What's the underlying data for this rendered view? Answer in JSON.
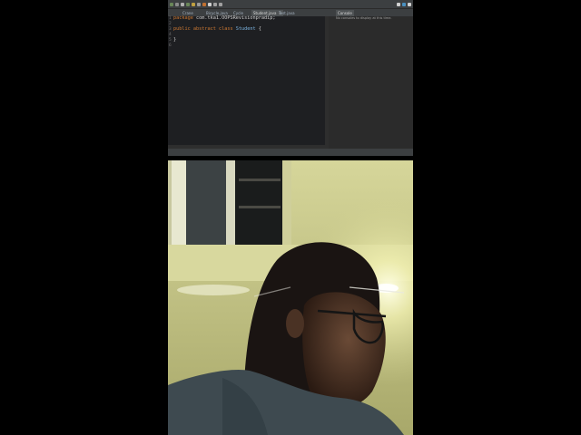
{
  "ide": {
    "editor_tabs": [
      {
        "label": "Crane"
      },
      {
        "label": "Bicycle.java"
      },
      {
        "label": "Cycle"
      },
      {
        "label": "Student.java",
        "active": true
      },
      {
        "label": "Test.java"
      }
    ],
    "console_tab": {
      "label": "Console"
    },
    "console_message": "No consoles to display at this time.",
    "line_numbers": [
      "1",
      "2",
      "3",
      "4",
      "5",
      "6"
    ],
    "code": {
      "line1_keyword": "package",
      "line1_rest": " com.tka1.OOPSRevisionpradip;",
      "line3_kw1": "public",
      "line3_kw2": "abstract",
      "line3_kw3": "class",
      "line3_class": "Student",
      "line3_brace": " {",
      "line5": "}"
    },
    "colors": {
      "keyword": "#cc7832",
      "class_name": "#7ab3e0",
      "editor_bg": "#1e1f22"
    }
  },
  "webcam": {
    "description_icon": "webcam-feed"
  }
}
